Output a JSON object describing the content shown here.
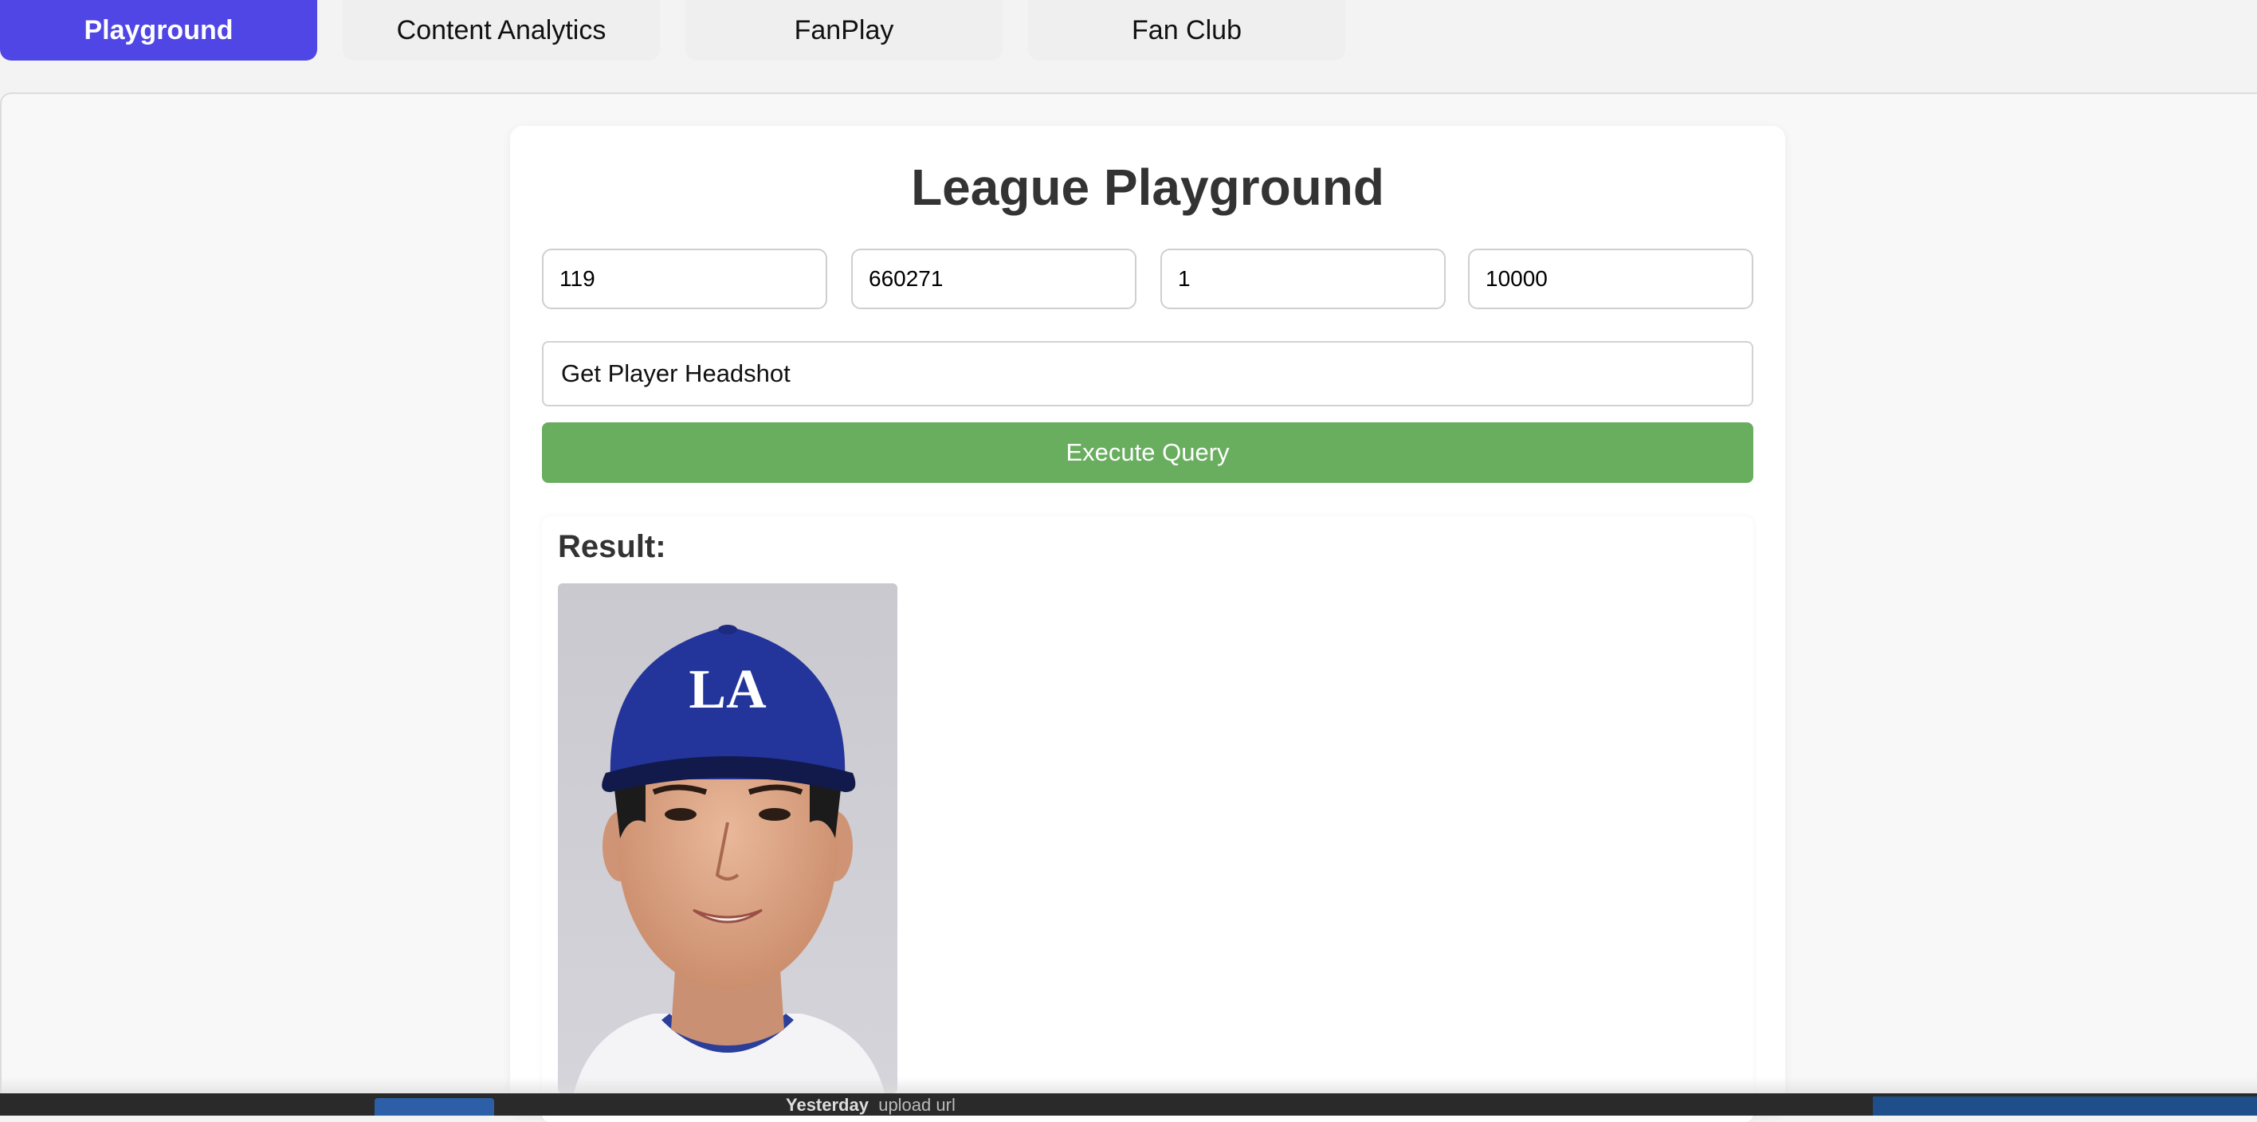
{
  "tabs": [
    {
      "label": "Playground",
      "active": true
    },
    {
      "label": "Content Analytics",
      "active": false
    },
    {
      "label": "FanPlay",
      "active": false
    },
    {
      "label": "Fan Club",
      "active": false
    }
  ],
  "playground": {
    "title": "League Playground",
    "inputs": [
      "119",
      "660271",
      "1",
      "10000"
    ],
    "query_select": "Get Player Headshot",
    "execute_label": "Execute Query",
    "result_label": "Result:"
  },
  "taskbar": {
    "label": "Yesterday",
    "detail": "upload url"
  },
  "colors": {
    "active_tab": "#5046e5",
    "execute_button": "#69ae5f",
    "cap": "#23349a"
  }
}
